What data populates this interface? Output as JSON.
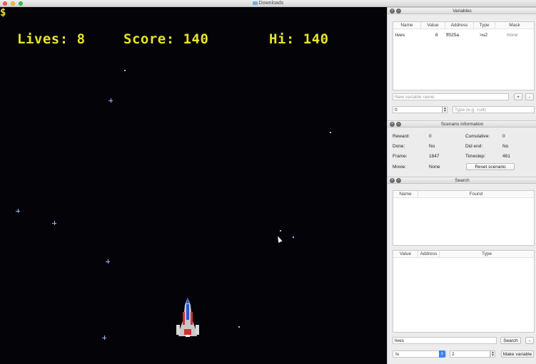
{
  "window": {
    "title": "Downloads"
  },
  "hud": {
    "lives": "Lives: 8",
    "score": "Score: 140",
    "hi": "Hi: 140",
    "currency": "$"
  },
  "variables": {
    "title": "Variables",
    "columns": [
      "Name",
      "Value",
      "Address",
      "Type",
      "Mask"
    ],
    "rows": [
      {
        "name": "lives",
        "value": "8",
        "address": "ff025a",
        "type": ">u2",
        "mask": "None"
      }
    ],
    "new_name_placeholder": "New variable name",
    "add_label": "+",
    "remove_label": "-",
    "address_value": "0",
    "type_placeholder": "Type (e.g. <u4)"
  },
  "scenario": {
    "title": "Scenario information",
    "reward_label": "Reward:",
    "reward": "0",
    "cumulative_label": "Cumulative:",
    "cumulative": "0",
    "done_label": "Done:",
    "done": "No",
    "did_end_label": "Did end:",
    "did_end": "No",
    "frame_label": "Frame:",
    "frame": "1847",
    "timestep_label": "Timestep:",
    "timestep": "461",
    "movie_label": "Movie:",
    "movie": "None",
    "reset_label": "Reset scenario"
  },
  "search": {
    "title": "Search",
    "results_columns": [
      "Name",
      "Found"
    ],
    "detail_columns": [
      "Value",
      "Address",
      "Type"
    ],
    "query": "lives",
    "search_label": "Search",
    "remove_label": "-",
    "op_value": "Is",
    "compare_value": "2",
    "make_variable_label": "Make variable"
  },
  "colors": {
    "hud_yellow": "#e8e32a",
    "space": "#030308",
    "star": "#9fb4ff"
  }
}
